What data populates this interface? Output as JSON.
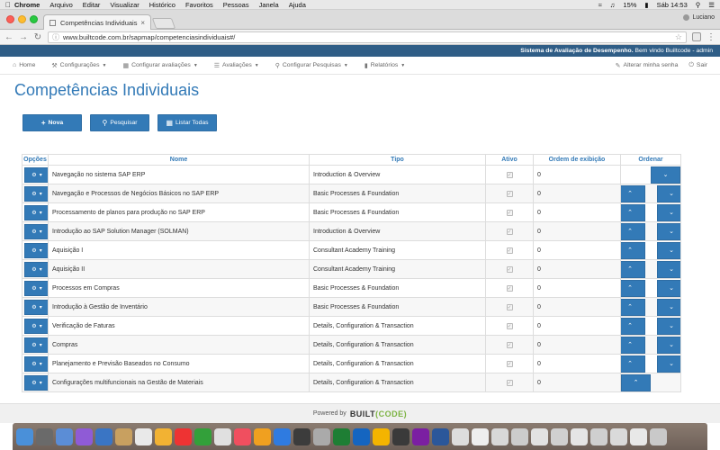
{
  "menubar": {
    "app": "Chrome",
    "items": [
      "Arquivo",
      "Editar",
      "Visualizar",
      "Histórico",
      "Favoritos",
      "Pessoas",
      "Janela",
      "Ajuda"
    ],
    "battery": "15%",
    "clock": "Sáb 14:53"
  },
  "browser": {
    "tab_title": "Competências Individuais",
    "url": "www.builtcode.com.br/sapmap/competenciasindividuais#/",
    "profile": "Luciano"
  },
  "header": {
    "system_name": "Sistema de Avaliação de Desempenho.",
    "welcome": " Bem vindo Builtcode - admin"
  },
  "nav": {
    "home": "Home",
    "configuracoes": "Configurações",
    "configurar_avaliacoes": "Configurar avaliações",
    "avaliacoes": "Avaliações",
    "configurar_pesquisas": "Configurar Pesquisas",
    "relatorios": "Relatórios",
    "alterar_senha": "Alterar minha senha",
    "sair": "Sair"
  },
  "page": {
    "title": "Competências Individuais",
    "btn_nova": "Nova",
    "btn_pesquisar": "Pesquisar",
    "btn_listar": "Listar Todas"
  },
  "table": {
    "headers": {
      "opcoes": "Opções",
      "nome": "Nome",
      "tipo": "Tipo",
      "ativo": "Ativo",
      "ordem": "Ordem de exibição",
      "ordenar": "Ordenar"
    },
    "rows": [
      {
        "nome": "Navegação no sistema SAP ERP",
        "tipo": "Introduction & Overview",
        "ordem": "0",
        "up": false,
        "down": true
      },
      {
        "nome": "Navegação e Processos de Negócios Básicos no SAP ERP",
        "tipo": "Basic Processes & Foundation",
        "ordem": "0",
        "up": true,
        "down": true
      },
      {
        "nome": "Processamento de planos para produção no SAP ERP",
        "tipo": "Basic Processes & Foundation",
        "ordem": "0",
        "up": true,
        "down": true
      },
      {
        "nome": "Introdução ao SAP Solution Manager (SOLMAN)",
        "tipo": "Introduction & Overview",
        "ordem": "0",
        "up": true,
        "down": true
      },
      {
        "nome": "Aquisição I",
        "tipo": "Consultant Academy Training",
        "ordem": "0",
        "up": true,
        "down": true
      },
      {
        "nome": "Aquisição II",
        "tipo": "Consultant Academy Training",
        "ordem": "0",
        "up": true,
        "down": true
      },
      {
        "nome": "Processos em Compras",
        "tipo": "Basic Processes & Foundation",
        "ordem": "0",
        "up": true,
        "down": true
      },
      {
        "nome": "Introdução à Gestão de Inventário",
        "tipo": "Basic Processes & Foundation",
        "ordem": "0",
        "up": true,
        "down": true
      },
      {
        "nome": "Verificação de Faturas",
        "tipo": "Details, Configuration & Transaction",
        "ordem": "0",
        "up": true,
        "down": true
      },
      {
        "nome": "Compras",
        "tipo": "Details, Configuration & Transaction",
        "ordem": "0",
        "up": true,
        "down": true
      },
      {
        "nome": "Planejamento e Previsão Baseados no Consumo",
        "tipo": "Details, Configuration & Transaction",
        "ordem": "0",
        "up": true,
        "down": true
      },
      {
        "nome": "Configurações multifuncionais na Gestão de Materiais",
        "tipo": "Details, Configuration & Transaction",
        "ordem": "0",
        "up": true,
        "down": false
      }
    ]
  },
  "footer": {
    "powered": "Powered by",
    "logo_a": "BUILT",
    "logo_b": "(CODE",
    "logo_c": ")"
  },
  "colors": {
    "primary": "#337ab7",
    "header_bar": "#2f5d86"
  },
  "dock_colors": [
    "#4a90d9",
    "#6a6a6a",
    "#5b8dd6",
    "#8f5bd6",
    "#3a75c4",
    "#c8a060",
    "#e9e9e9",
    "#f2b233",
    "#e33",
    "#33a03a",
    "#e0e0e0",
    "#f04f5f",
    "#f0a020",
    "#2f7be0",
    "#3c3c3c",
    "#aaaaaa",
    "#1e7e34",
    "#1565c0",
    "#f4b400",
    "#3a3a3a",
    "#7b1fa2",
    "#2b579a",
    "#dddddd",
    "#eeeeee",
    "#d8d8d8",
    "#cccccc",
    "#e2e2e2",
    "#d0d0d0",
    "#e5e5e5",
    "#cfcfcf",
    "#dadada",
    "#e8e8e8",
    "#c9c9c9"
  ]
}
